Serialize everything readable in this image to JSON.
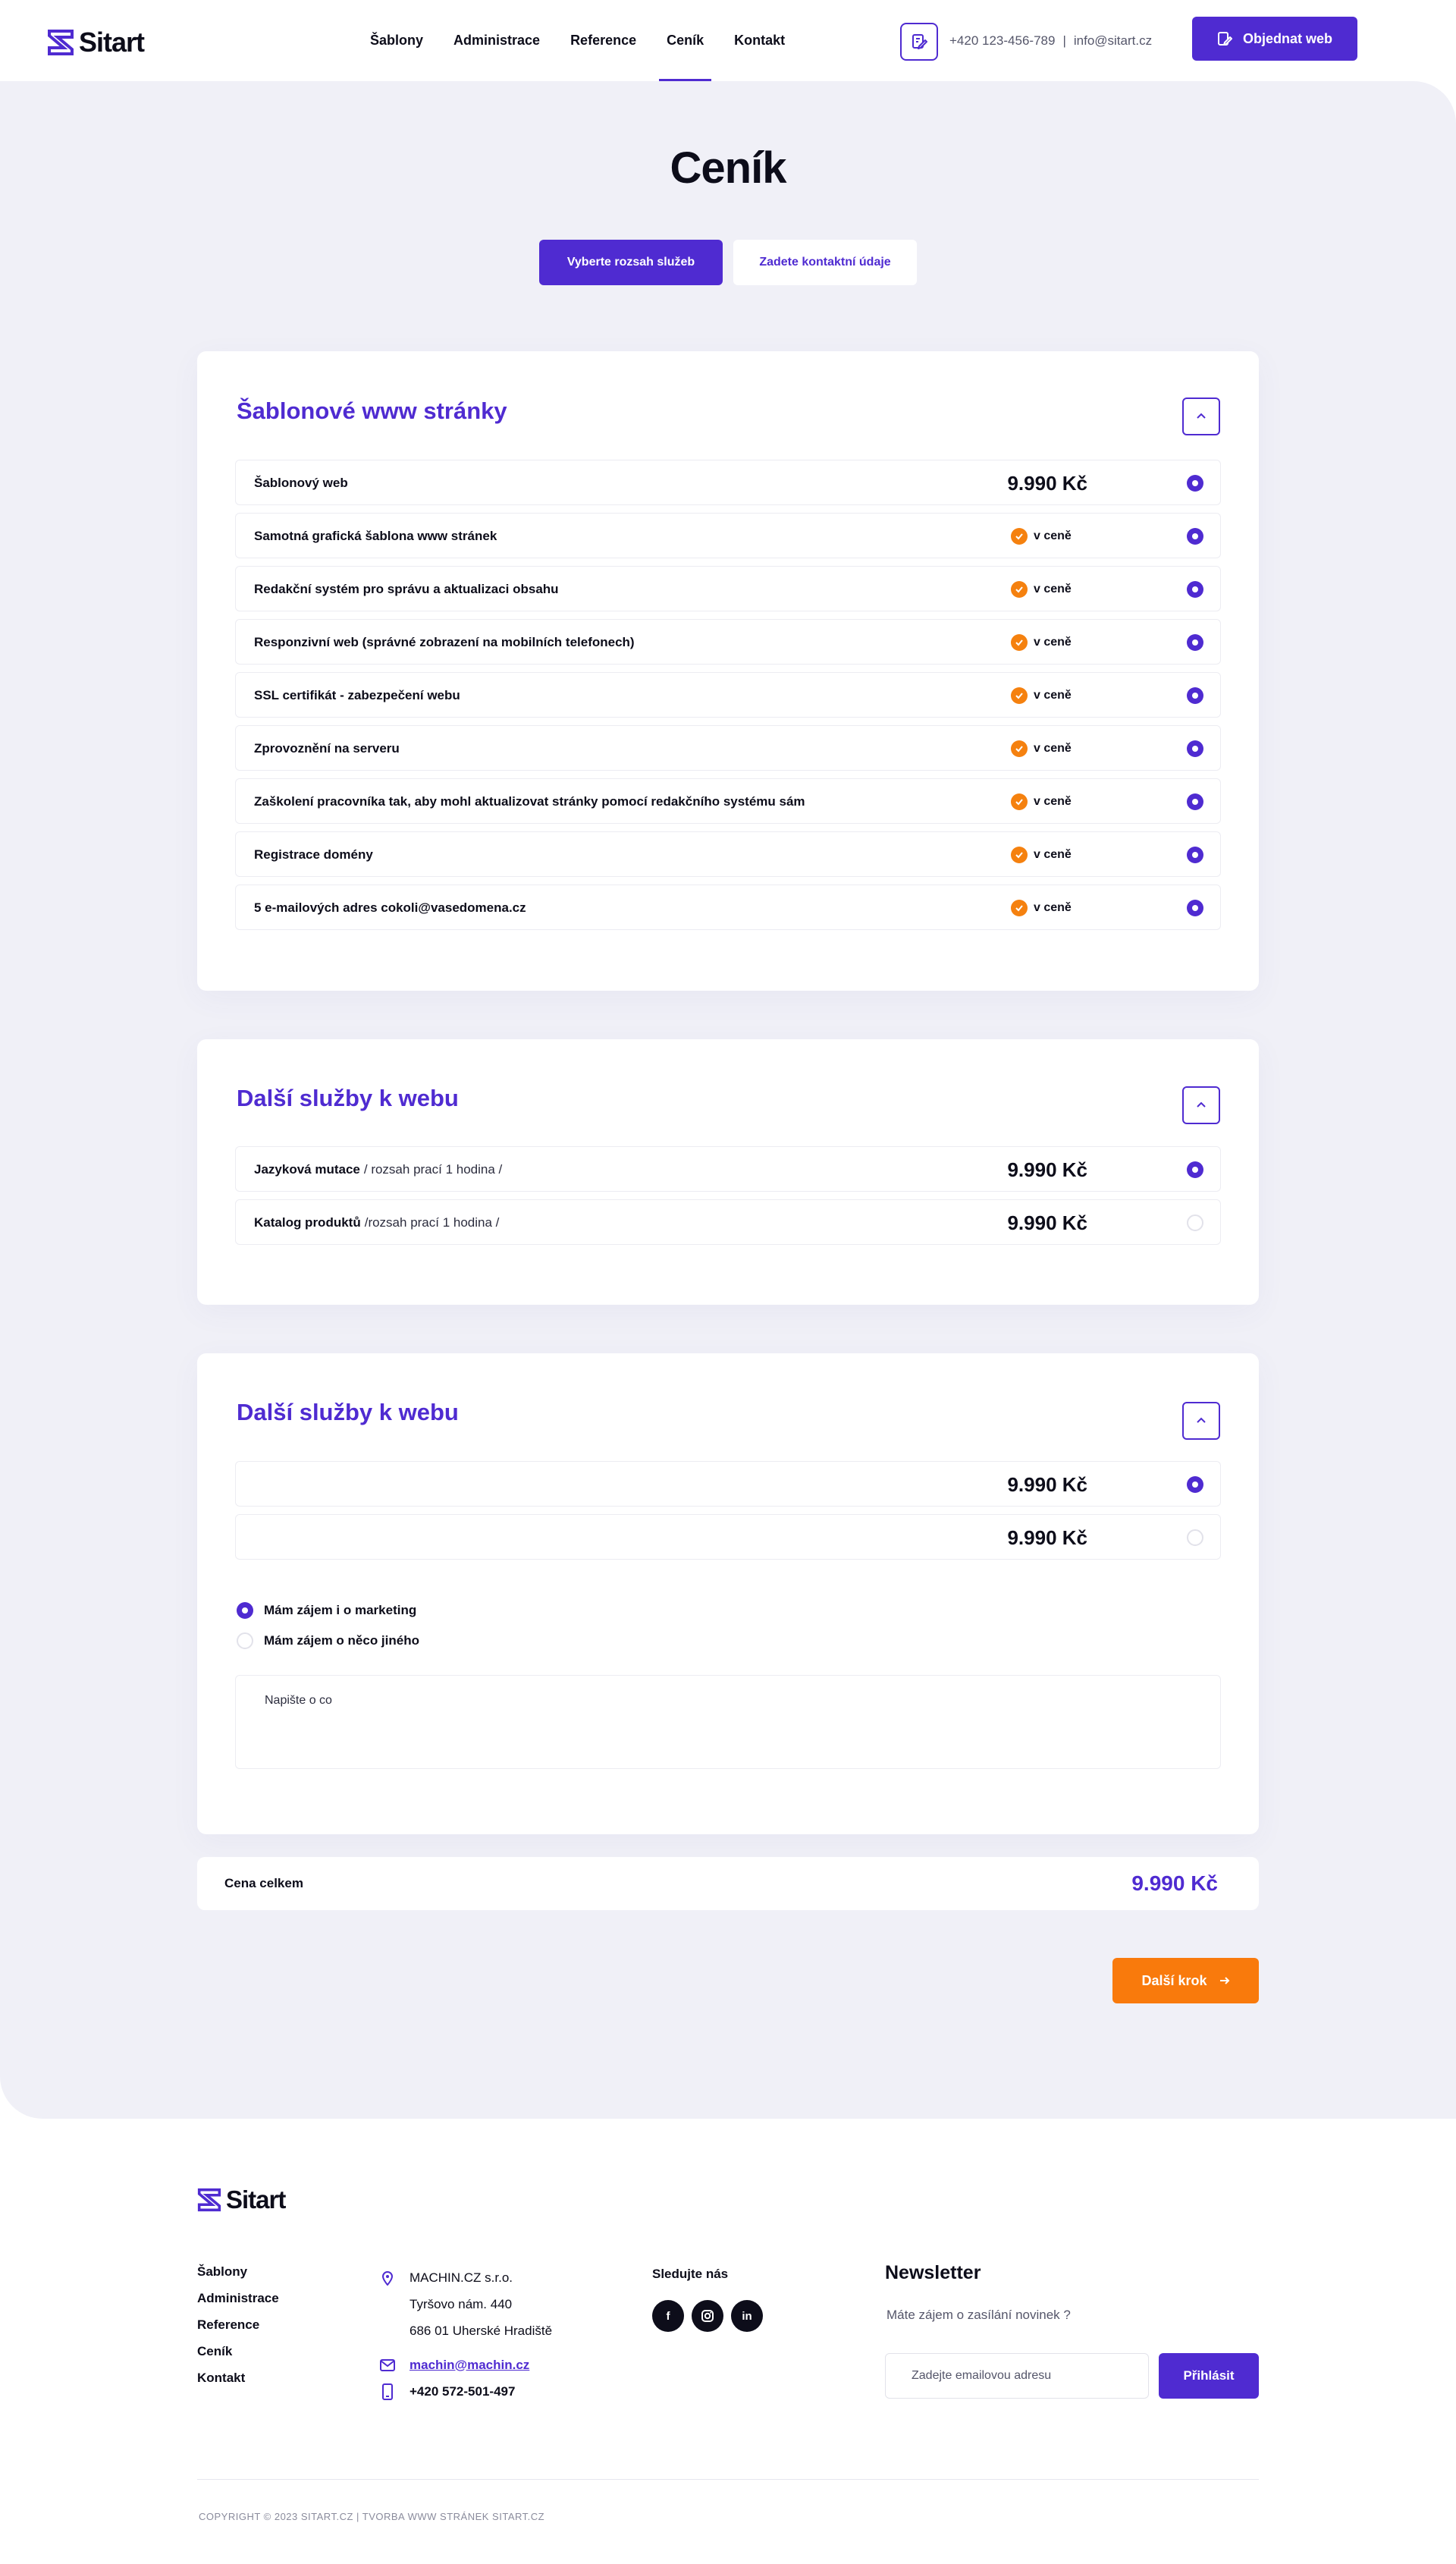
{
  "brand": {
    "name": "Sitart",
    "accent": "#4f2bd1",
    "orange": "#f97a0c"
  },
  "nav": {
    "items": [
      {
        "label": "Šablony"
      },
      {
        "label": "Administrace"
      },
      {
        "label": "Reference"
      },
      {
        "label": "Ceník",
        "active": true
      },
      {
        "label": "Kontakt"
      }
    ]
  },
  "header": {
    "phone": "+420 123-456-789",
    "separator": "|",
    "email": "info@sitart.cz",
    "order_label": "Objednat web"
  },
  "page": {
    "title": "Ceník",
    "steps": [
      {
        "label": "Vyberte rozsah služeb",
        "active": true
      },
      {
        "label": "Zadete kontaktní údaje",
        "active": false
      }
    ]
  },
  "sections": [
    {
      "title": "Šablonové www stránky",
      "rows": [
        {
          "label": "Šablonový web",
          "price": "9.990 Kč",
          "selected": true
        },
        {
          "label": "Samotná grafická šablona www stránek",
          "included": "v ceně",
          "selected": true
        },
        {
          "label": "Redakční systém pro správu a aktualizaci obsahu",
          "included": "v ceně",
          "selected": true
        },
        {
          "label": "Responzivní web (správné zobrazení na mobilních telefonech)",
          "included": "v ceně",
          "selected": true
        },
        {
          "label": "SSL certifikát - zabezpečení webu",
          "included": "v ceně",
          "selected": true
        },
        {
          "label": "Zprovoznění na serveru",
          "included": "v ceně",
          "selected": true
        },
        {
          "label": "Zaškolení pracovníka tak, aby mohl aktualizovat stránky pomocí redakčního systému sám",
          "included": "v ceně",
          "selected": true
        },
        {
          "label": "Registrace domény",
          "included": "v ceně",
          "selected": true
        },
        {
          "label": "5 e-mailových adres cokoli@vasedomena.cz",
          "included": "v ceně",
          "selected": true
        }
      ]
    },
    {
      "title": "Další služby k webu",
      "rows": [
        {
          "label": "Jazyková mutace",
          "sub": "/ rozsah prací 1 hodina /",
          "price": "9.990 Kč",
          "selected": true
        },
        {
          "label": "Katalog produktů",
          "sub": "/rozsah prací 1 hodina /",
          "price": "9.990 Kč",
          "selected": false
        }
      ]
    },
    {
      "title": "Další služby k webu",
      "rows": [
        {
          "label": "",
          "price": "9.990 Kč",
          "selected": true
        },
        {
          "label": "",
          "price": "9.990 Kč",
          "selected": false
        }
      ],
      "options": [
        {
          "label": "Mám zájem i o marketing",
          "selected": true
        },
        {
          "label": "Mám zájem o něco jiného",
          "selected": false
        }
      ],
      "textarea_placeholder": "Napište o co"
    }
  ],
  "total": {
    "label": "Cena celkem",
    "value": "9.990 Kč"
  },
  "next_label": "Další krok",
  "footer": {
    "links": [
      "Šablony",
      "Administrace",
      "Reference",
      "Ceník",
      "Kontakt"
    ],
    "company": "MACHIN.CZ s.r.o.",
    "street": "Tyršovo nám. 440",
    "city": "686 01 Uherské Hradiště",
    "email": "machin@machin.cz",
    "phone": "+420 572-501-497",
    "follow_label": "Sledujte nás",
    "socials": [
      "f",
      "ig",
      "in"
    ],
    "newsletter_title": "Newsletter",
    "newsletter_sub": "Máte zájem o zasílání novinek ?",
    "newsletter_placeholder": "Zadejte emailovou adresu",
    "newsletter_button": "Přihlásit",
    "copyright": "COPYRIGHT © 2023 SITART.CZ  |  TVORBA WWW STRÁNEK SITART.CZ"
  }
}
